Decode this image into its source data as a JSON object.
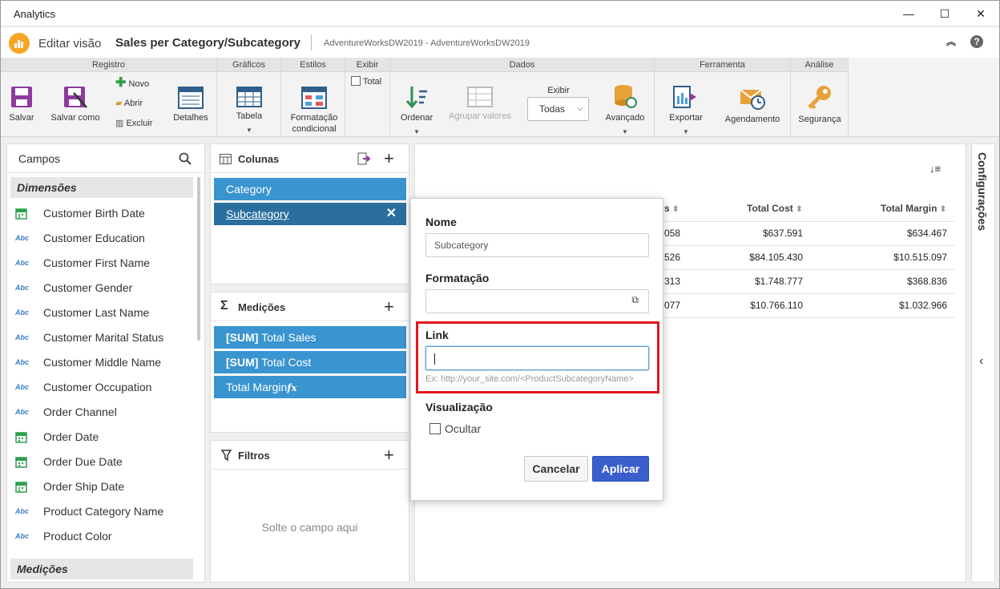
{
  "window": {
    "title": "Analytics",
    "minimize": "—",
    "maximize": "☐",
    "close": "✕"
  },
  "header": {
    "mode": "Editar visão",
    "title": "Sales per Category/Subcategory",
    "database": "AdventureWorksDW2019 - AdventureWorksDW2019"
  },
  "ribbon": {
    "groups": {
      "registro": "Registro",
      "graficos": "Gráficos",
      "estilos": "Estilos",
      "exibir": "Exibir",
      "dados": "Dados",
      "ferramenta": "Ferramenta",
      "analise": "Análise"
    },
    "salvar": "Salvar",
    "salvar_como": "Salvar como",
    "novo": "Novo",
    "abrir": "Abrir",
    "excluir": "Excluir",
    "detalhes": "Detalhes",
    "tabela": "Tabela",
    "formatacao_1": "Formatação",
    "formatacao_2": "condicional",
    "total": "Total",
    "ordenar": "Ordenar",
    "agrupar": "Agrupar valores",
    "exibir_label": "Exibir",
    "exibir_value": "Todas",
    "avancado": "Avançado",
    "exportar": "Exportar",
    "agendamento": "Agendamento",
    "seguranca": "Segurança"
  },
  "fields": {
    "title": "Campos",
    "dim_header": "Dimensões",
    "items": [
      {
        "type": "date",
        "label": "Customer Birth Date"
      },
      {
        "type": "text",
        "label": "Customer Education"
      },
      {
        "type": "text",
        "label": "Customer First Name"
      },
      {
        "type": "text",
        "label": "Customer Gender"
      },
      {
        "type": "text",
        "label": "Customer Last Name"
      },
      {
        "type": "text",
        "label": "Customer Marital Status"
      },
      {
        "type": "text",
        "label": "Customer Middle Name"
      },
      {
        "type": "text",
        "label": "Customer Occupation"
      },
      {
        "type": "text",
        "label": "Order Channel"
      },
      {
        "type": "date",
        "label": "Order Date"
      },
      {
        "type": "date",
        "label": "Order Due Date"
      },
      {
        "type": "date",
        "label": "Order Ship Date"
      },
      {
        "type": "text",
        "label": "Product Category Name"
      },
      {
        "type": "text",
        "label": "Product Color"
      }
    ],
    "abc": "Abc",
    "meas_header": "Medições"
  },
  "columns": {
    "title": "Colunas",
    "items": [
      "Category",
      "Subcategory"
    ]
  },
  "measures": {
    "title": "Medições",
    "items": [
      {
        "agg": "[SUM]",
        "name": "Total Sales"
      },
      {
        "agg": "[SUM]",
        "name": "Total Cost"
      },
      {
        "agg": "",
        "name": "Total Margin"
      }
    ],
    "fx": "fx"
  },
  "filters": {
    "title": "Filtros",
    "drop_hint": "Solte o campo aqui"
  },
  "table": {
    "headers": [
      "s",
      "Total Cost",
      "Total Margin"
    ],
    "rows": [
      [
        "058",
        "$637.591",
        "$634.467"
      ],
      [
        "526",
        "$84.105.430",
        "$10.515.097"
      ],
      [
        "313",
        "$1.748.777",
        "$368.836"
      ],
      [
        "077",
        "$10.766.110",
        "$1.032.966"
      ]
    ]
  },
  "side": {
    "label": "Configurações"
  },
  "modal": {
    "name_label": "Nome",
    "name_value": "Subcategory",
    "format_label": "Formatação",
    "link_label": "Link",
    "link_value": "",
    "link_hint": "Ex: http://your_site.com/<ProductSubcategoryName>",
    "vis_label": "Visualização",
    "hide_label": "Ocultar",
    "cancel": "Cancelar",
    "apply": "Aplicar"
  },
  "colors": {
    "accent": "#3a94d0",
    "selected": "#2a6f9e",
    "primary": "#3a5fcd",
    "highlight": "#e0171c"
  }
}
